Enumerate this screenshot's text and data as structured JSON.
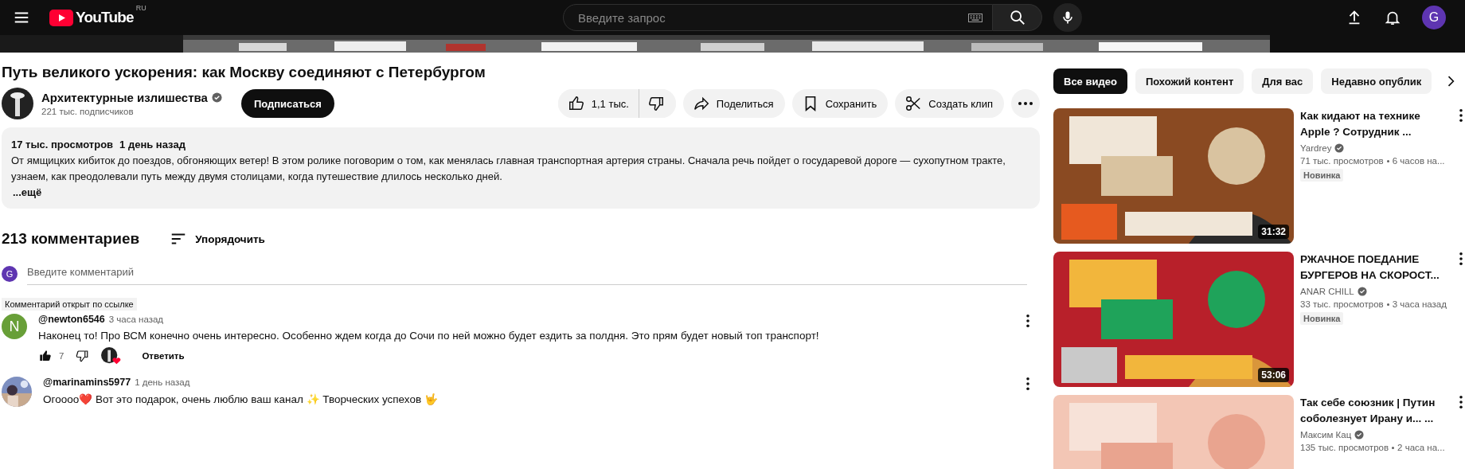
{
  "header": {
    "logo": "YouTube",
    "region": "RU",
    "search": {
      "placeholder": "Введите запрос"
    },
    "avatar": "G"
  },
  "video": {
    "title": "Путь великого ускорения: как Москву соединяют с Петербургом",
    "channel": {
      "name": "Архитектурные излишества",
      "verified": true,
      "subscribers": "221 тыс. подписчиков"
    },
    "subscribe": "Подписаться",
    "likes": "1,1 тыс.",
    "actions": [
      {
        "kind": "share",
        "label": "Поделиться"
      },
      {
        "kind": "save",
        "label": "Сохранить"
      },
      {
        "kind": "clip",
        "label": "Создать клип"
      }
    ],
    "description": {
      "views": "17 тыс. просмотров",
      "date": "1 день назад",
      "text": "От ямщицких кибиток до поездов, обгоняющих ветер! В этом ролике поговорим о том, как менялась главная транспортная артерия страны. Сначала речь пойдет о государевой дороге — сухопутном тракте, узнаем, как преодолевали путь между двумя столицами, когда путешествие длилось несколько дней.",
      "more": "...ещё"
    }
  },
  "comments": {
    "count": "213 комментариев",
    "sort": "Упорядочить",
    "input": {
      "avatar": "G",
      "placeholder": "Введите комментарий"
    },
    "items": [
      {
        "badge": "Комментарий открыт по ссылке",
        "avatar": {
          "kind": "letter",
          "letter": "N",
          "color": "#689f38"
        },
        "author": "@newton6546",
        "time": "3 часа назад",
        "text": "Наконец то! Про ВСМ конечно очень интересно. Особенно ждем когда до Сочи по ней можно будет ездить за полдня. Это прям будет новый топ транспорт!",
        "likes": "7",
        "creator_heart": true,
        "reply": "Ответить"
      },
      {
        "author": "@marinamins5977",
        "time": "1 день назад",
        "text": "Огоооо❤️  Вот это подарок, очень люблю ваш канал ✨ Творческих успехов 🤟"
      }
    ]
  },
  "sidebar": {
    "chips": [
      {
        "label": "Все видео",
        "selected": true
      },
      {
        "label": "Похожий контент",
        "selected": false
      },
      {
        "label": "Для вас",
        "selected": false
      },
      {
        "label": "Недавно опублик",
        "selected": false
      }
    ],
    "videos": [
      {
        "title": "Как кидают на технике Apple ? Сотрудник ...",
        "channel": "Yardrey",
        "verified": true,
        "views": "71 тыс. просмотров",
        "time": "6 часов на...",
        "badge": "Новинка",
        "duration": "31:32"
      },
      {
        "title": "РЖАЧНОЕ ПОЕДАНИЕ БУРГЕРОВ НА СКОРОСТ...",
        "channel": "ANAR CHILL",
        "verified": true,
        "views": "33 тыс. просмотров",
        "time": "3 часа назад",
        "badge": "Новинка",
        "duration": "53:06"
      },
      {
        "title": "Так себе союзник | Путин соболезнует Ирану и... ...",
        "channel": "Максим Кац",
        "verified": true,
        "views": "135 тыс. просмотров",
        "time": "2 часа на..."
      }
    ]
  }
}
